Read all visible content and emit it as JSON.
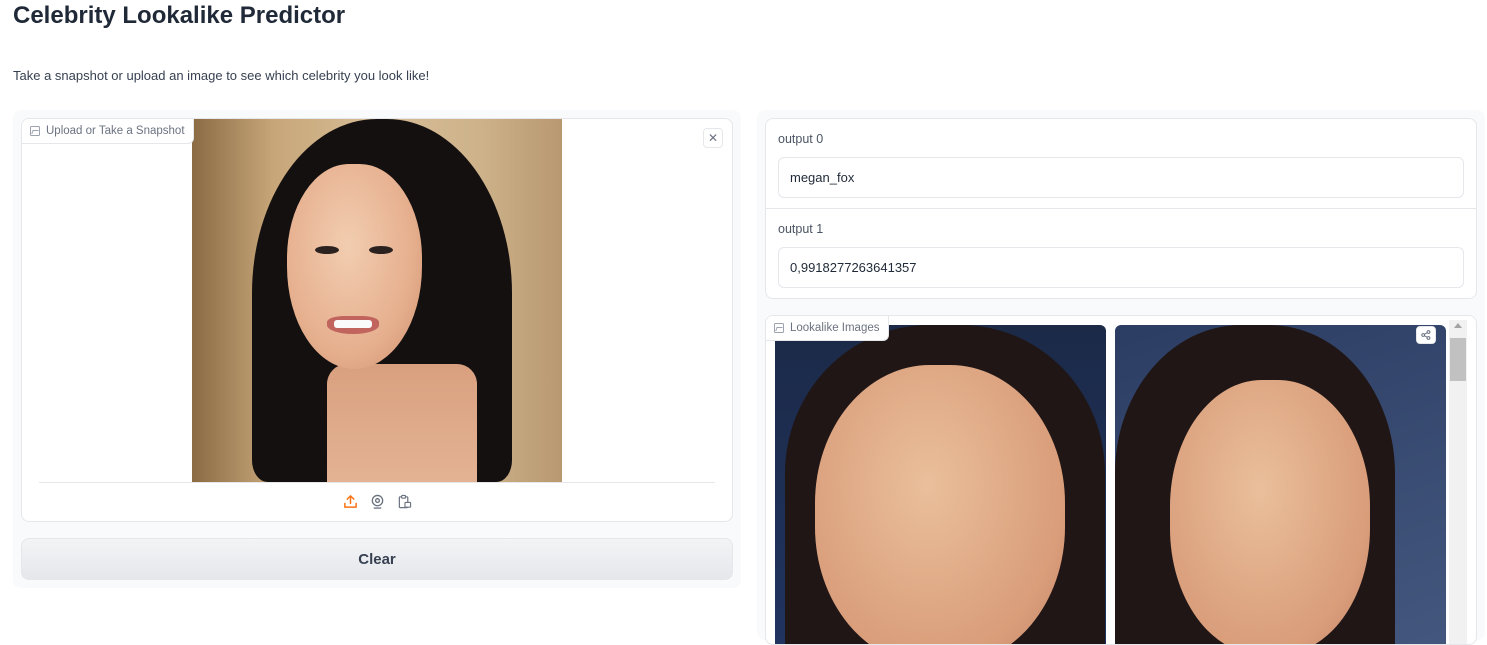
{
  "header": {
    "title": "Celebrity Lookalike Predictor",
    "description": "Take a snapshot or upload an image to see which celebrity you look like!"
  },
  "input": {
    "label": "Upload or Take a Snapshot",
    "label_icon": "image-icon",
    "close_icon": "close-icon",
    "close_glyph": "✕",
    "sources": [
      "upload-icon",
      "webcam-icon",
      "clipboard-icon"
    ]
  },
  "clear_button": {
    "label": "Clear"
  },
  "outputs": [
    {
      "label": "output 0",
      "value": "megan_fox"
    },
    {
      "label": "output 1",
      "value": "0,9918277263641357"
    }
  ],
  "gallery": {
    "label": "Lookalike Images",
    "label_icon": "image-icon",
    "share_icon": "share-icon"
  },
  "colors": {
    "accent": "#f97316",
    "border": "#e5e7eb",
    "muted_text": "#6b7280"
  }
}
